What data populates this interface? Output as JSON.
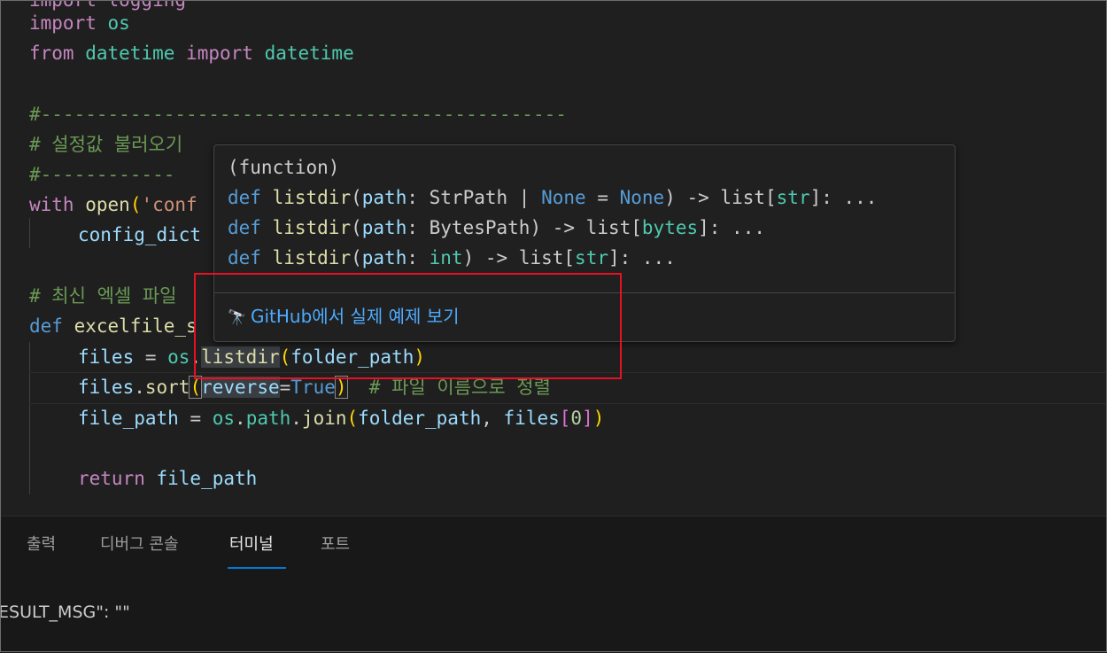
{
  "editor": {
    "lines": {
      "l0": "import logging",
      "l1_kw": "import",
      "l1_mod": "os",
      "l2_from": "from",
      "l2_mod": "datetime",
      "l2_import": "import",
      "l2_cls": "datetime",
      "l4": "#-----------------------------------------------",
      "l5": "# 설정값 불러오기",
      "l6": "#------------",
      "l7_with": "with",
      "l7_open": "open",
      "l7_paren": "(",
      "l7_str": "'conf",
      "l8": "config_dict",
      "l10": "# 최신 엑셀 파일",
      "l11_def": "def",
      "l11_fn": "excelfile_s",
      "l12_files": "files",
      "l12_eq": " = ",
      "l12_os": "os",
      "l12_dot": ".",
      "l12_fn": "listdir",
      "l12_open": "(",
      "l12_arg": "folder_path",
      "l12_close": ")",
      "l13_files": "files",
      "l13_dot": ".",
      "l13_fn": "sort",
      "l13_open": "(",
      "l13_kw": "reverse",
      "l13_eq": "=",
      "l13_val": "True",
      "l13_close": ")",
      "l13_cmt": "  # 파일 이름으로 정렬",
      "l14_var": "file_path",
      "l14_eq": " = ",
      "l14_os": "os",
      "l14_dot1": ".",
      "l14_path": "path",
      "l14_dot2": ".",
      "l14_fn": "join",
      "l14_open": "(",
      "l14_arg": "folder_path",
      "l14_comma": ", ",
      "l14_files": "files",
      "l14_ob": "[",
      "l14_num": "0",
      "l14_cb": "]",
      "l14_close": ")",
      "l16_ret": "return",
      "l16_var": " file_path"
    }
  },
  "hover": {
    "kind": "(function)",
    "signatures": [
      {
        "def": "def",
        "name": "listdir",
        "open": "(",
        "param": "path",
        "colon": ": ",
        "type": "StrPath",
        "pipe": " | ",
        "none1": "None",
        "eq": " = ",
        "none2": "None",
        "close": ")",
        "arrow": " -> ",
        "ret": "list",
        "ob": "[",
        "rtype": "str",
        "rest": "]: ..."
      },
      {
        "def": "def",
        "name": "listdir",
        "open": "(",
        "param": "path",
        "colon": ": ",
        "type": "BytesPath",
        "close": ")",
        "arrow": " -> ",
        "ret": "list",
        "ob": "[",
        "rtype": "bytes",
        "rest": "]: ..."
      },
      {
        "def": "def",
        "name": "listdir",
        "open": "(",
        "param": "path",
        "colon": ": ",
        "type": "int",
        "close": ")",
        "arrow": " -> ",
        "ret": "list",
        "ob": "[",
        "rtype": "str",
        "rest": "]: ..."
      }
    ],
    "github_link": "GitHub에서 실제 예제 보기",
    "github_icon": "telescope-icon"
  },
  "panel": {
    "tabs": [
      "출력",
      "디버그 콘솔",
      "터미널",
      "포트"
    ],
    "active_tab": "터미널",
    "terminal_line": "ESULT_MSG\": \"\""
  },
  "colors": {
    "highlight_box": "#e81123",
    "link": "#4daafc",
    "active_tab_underline": "#0078d4"
  }
}
